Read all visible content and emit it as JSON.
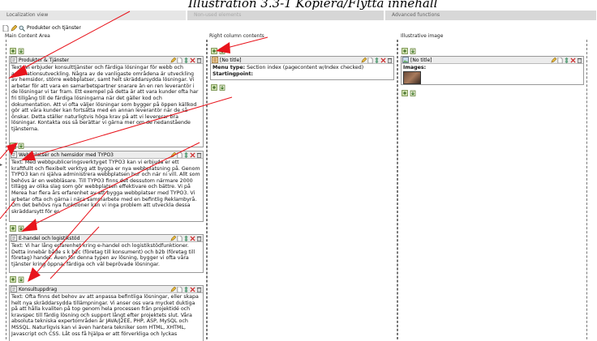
{
  "caption": "Illustration 3.3-1 Kopiera/Flytta innehåll",
  "tabs": [
    {
      "label": "Localization view"
    },
    {
      "label": "Non-used elements"
    },
    {
      "label": "Advanced functions"
    }
  ],
  "page": {
    "title": "Produkter och tjänster"
  },
  "columns": {
    "main": "Main Content Area",
    "right": "Right column contents",
    "illustrative": "Illustrative image"
  },
  "records": {
    "r1": {
      "title": "Produkter & Tjänster",
      "text": "Text: Vi erbjuder konsulttjänster och färdiga lösningar för webb och applikationsutveckling. Några av de vanligaste områdena är utveckling av hemsidor, större webbplatser, samt helt skräddarsydda lösningar. Vi arbetar för att vara en samarbetspartner snarare än en ren leverantör i de lösningar vi tar fram. Ett exempel på detta är att vara kunder ofta har fri tillgång till de färdiga lösningarna när det gäller kod och dokumentation. Att vi ofta väljer lösningar som bygger på öppen källkod gör att våra kunder kan fortsätta med en annan leverantör när de så önskar. Detta ställer naturligtvis höga krav på att vi levererar bra lösningar. Kontakta oss så berättar vi gärna mer om de nedanstående tjänsterna."
    },
    "r2": {
      "title": "Webbplatser och hemsidor med TYPO3",
      "text": "Text: Med webbpubliceringsverktyget TYPO3 kan vi erbjuda er ett kraftfullt och flexibelt verktyg att bygga er nya webbplatsning på. Genom TYPO3 kan ni själva administrera webbplatsen hur och när ni vill. Allt som behövs är en webbläsare. Till TYPO3 finns det dessutom närmare 2000 tillägg av olika slag som gör webbplatsen effektivare och bättre. Vi på Merea har flera års erfarenhet av att bygga webbplatser med TYPO3. Vi arbetar ofta och gärna i nära sammarbete med en befintlig Reklambyrå. Om det behövs nya funktioner kan vi inga problem att utveckla dessa skräddarsytt för er."
    },
    "r3": {
      "title": "E-handel och logistikstöd",
      "text": "Text: Vi har lång erfarenhet kring e-handel och logistikstödfunktioner. Detta innebär både s k b2c (företag till konsument) och b2b (företag till företag) handel. Även för denna typen av lösning, bygger vi ofta våra tjänster kring öppna, färdiga och väl beprövade lösningar."
    },
    "r4": {
      "title": "Konsultuppdrag",
      "text": "Text: Ofta finns det behov av att anpassa befintliga lösningar, eller skapa helt nya skräddarsydda tillämpningar. Vi anser oss vara mycket duktiga på att hålla kvaliten på top genom hela processen från projektidé och kravspec till färdig lösning och support långt efter projektets slut. Våra absoluta tekniska expertområden är JAVA/J2EE, PHP, ASP, MySQL och MSSQL. Naturligvis kan vi även hantera tekniker som HTML, XHTML, Javascript och CSS. Låt oss få hjälpa er att förverkliga och lyckas"
    },
    "right": {
      "title": "[No title]",
      "menu_label": "Menu type:",
      "menu_value": "Section index (pagecontent w/Index checked)",
      "start_label": "Startingpoint:"
    },
    "image": {
      "title": "[No title]",
      "images_label": "Images:"
    }
  },
  "colors": {
    "arrow": "#e8141c",
    "tab": "#d8d8d8"
  }
}
